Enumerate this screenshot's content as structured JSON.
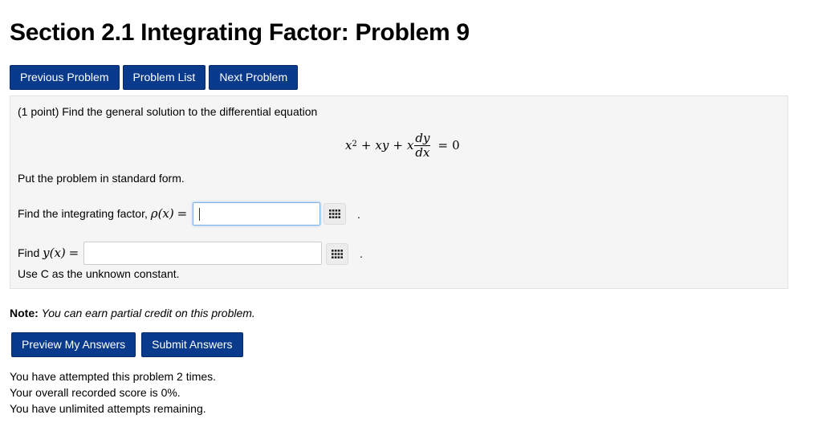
{
  "page": {
    "title": "Section 2.1 Integrating Factor: Problem 9"
  },
  "nav": {
    "previous": "Previous Problem",
    "list": "Problem List",
    "next": "Next Problem"
  },
  "problem": {
    "intro": "(1 point) Find the general solution to the differential equation",
    "equation": {
      "x_term": "x",
      "power": "2",
      "plus1": "+",
      "xy": "xy",
      "plus2": "+",
      "x_coef": "x",
      "numerator": "dy",
      "denominator": "dx",
      "equals": "=",
      "rhs": "0"
    },
    "standard_form": "Put the problem in standard form.",
    "integrating_factor": {
      "prefix": "Find the integrating factor,",
      "math": "ρ(x)",
      "equals": "="
    },
    "solution": {
      "prefix": "Find",
      "math": "y(x)",
      "equals": "="
    },
    "period": ".",
    "constant_note": "Use C as the unknown constant."
  },
  "note": {
    "label": "Note:",
    "text": "You can earn partial credit on this problem."
  },
  "actions": {
    "preview": "Preview My Answers",
    "submit": "Submit Answers"
  },
  "status": {
    "attempts": "You have attempted this problem 2 times.",
    "score": "Your overall recorded score is 0%.",
    "remaining": "You have unlimited attempts remaining."
  },
  "colors": {
    "button": "#093a8c",
    "panel": "#f5f5f5",
    "focus_border": "#7fb3e8"
  },
  "icons": {
    "equation_editor": "grid-icon"
  }
}
